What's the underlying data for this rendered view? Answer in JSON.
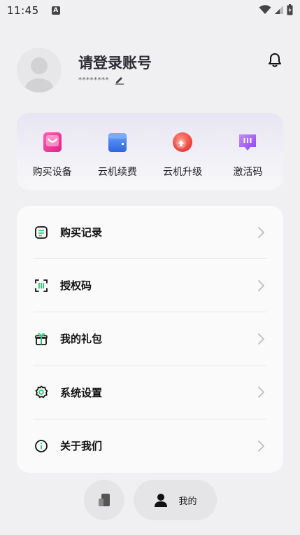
{
  "status_bar": {
    "time": "11:45",
    "badge": "A"
  },
  "profile": {
    "title": "请登录账号",
    "account_masked": "********"
  },
  "quick_actions": [
    {
      "label": "购买设备",
      "icon": "shopping-bag-icon",
      "color": "#e8328f"
    },
    {
      "label": "云机续费",
      "icon": "cloud-card-icon",
      "color": "#3f7be9"
    },
    {
      "label": "云机升级",
      "icon": "upgrade-icon",
      "color": "#ef4d4d"
    },
    {
      "label": "激活码",
      "icon": "activation-code-icon",
      "color": "#9b5cf0"
    }
  ],
  "menu": [
    {
      "label": "购买记录",
      "icon": "purchase-record-icon"
    },
    {
      "label": "授权码",
      "icon": "auth-code-icon"
    },
    {
      "label": "我的礼包",
      "icon": "gift-icon"
    },
    {
      "label": "系统设置",
      "icon": "settings-icon"
    },
    {
      "label": "关于我们",
      "icon": "info-icon"
    }
  ],
  "bottom_nav": {
    "mine_label": "我的"
  },
  "colors": {
    "accent_green": "#28c76f",
    "background": "#f0f0f2",
    "card": "#fafafa"
  }
}
